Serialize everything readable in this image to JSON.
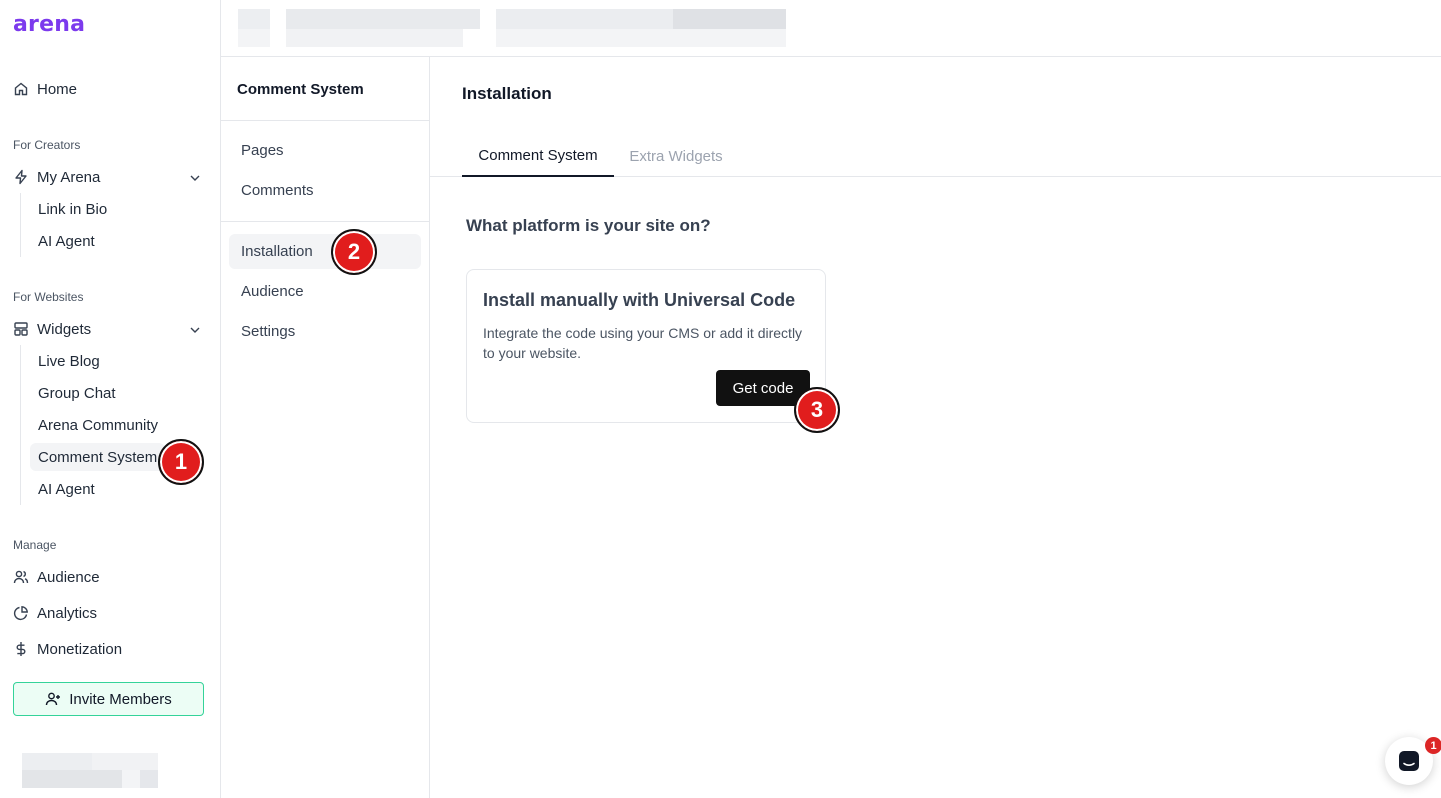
{
  "brand": {
    "logo": "arena",
    "accent": "#7c3aed"
  },
  "sidebar": {
    "home": "Home",
    "creators_title": "For Creators",
    "my_arena": "My Arena",
    "creator_items": [
      "Link in Bio",
      "AI Agent"
    ],
    "websites_title": "For Websites",
    "widgets": "Widgets",
    "widget_items": [
      "Live Blog",
      "Group Chat",
      "Arena Community",
      "Comment System",
      "AI Agent"
    ],
    "active_widget": "Comment System",
    "manage_title": "Manage",
    "manage_items": [
      {
        "label": "Audience",
        "icon": "users-icon"
      },
      {
        "label": "Analytics",
        "icon": "pie-chart-icon"
      },
      {
        "label": "Monetization",
        "icon": "dollar-icon"
      }
    ],
    "invite": "Invite Members"
  },
  "subnav": {
    "title": "Comment System",
    "group1": [
      "Pages",
      "Comments"
    ],
    "group2": [
      "Installation",
      "Audience",
      "Settings"
    ],
    "active": "Installation"
  },
  "main": {
    "title": "Installation",
    "tabs": [
      {
        "label": "Comment System",
        "active": true
      },
      {
        "label": "Extra Widgets",
        "active": false
      }
    ],
    "question": "What platform is your site on?",
    "card": {
      "title": "Install manually with Universal Code",
      "description": "Integrate the code using your CMS or add it directly to your website.",
      "button": "Get code"
    }
  },
  "badges": [
    "1",
    "2",
    "3"
  ],
  "chat": {
    "unread": "1"
  }
}
